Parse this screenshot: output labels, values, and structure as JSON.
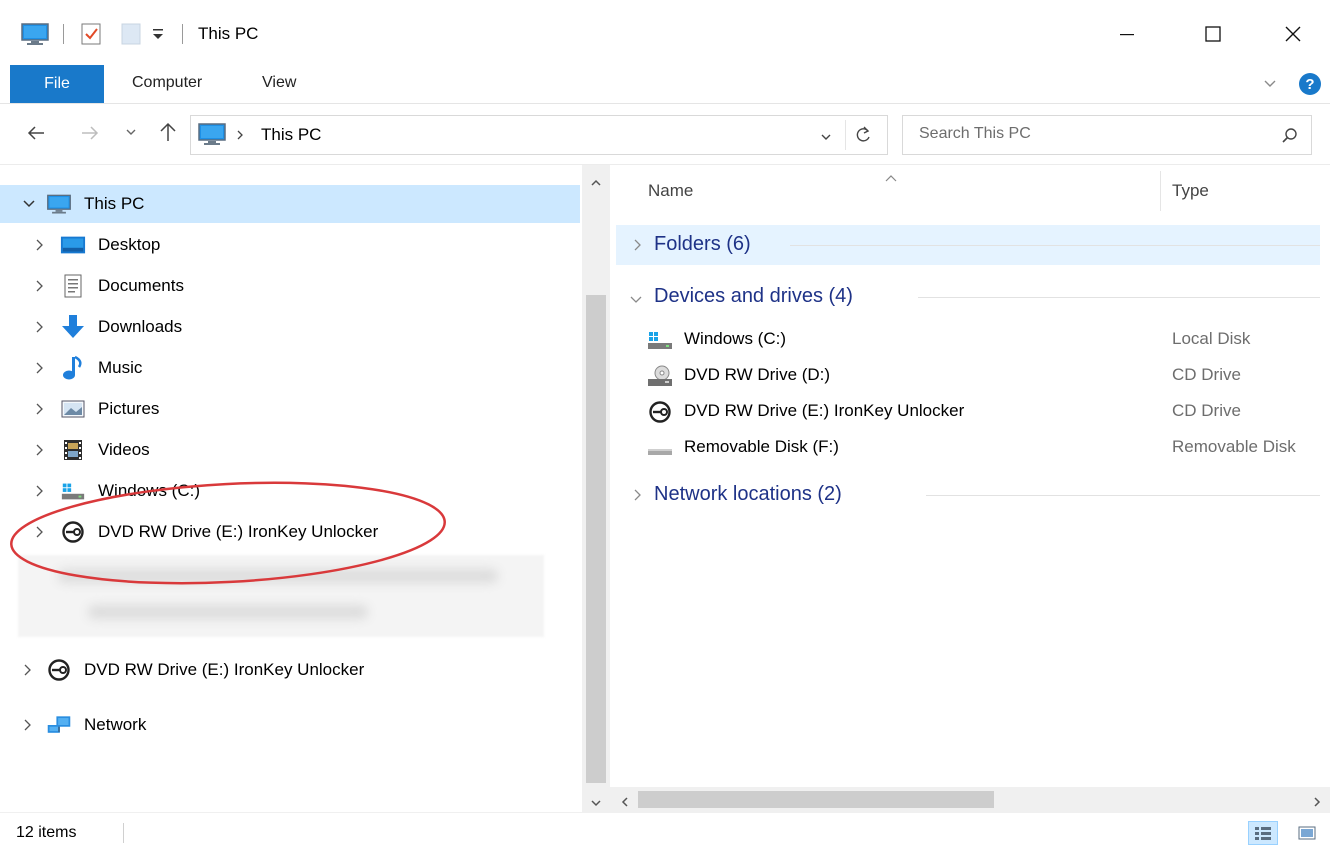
{
  "window": {
    "title": "This PC",
    "qat_dropdown_glyph": "=",
    "icon": "this-pc-icon"
  },
  "ribbon": {
    "tabs": [
      {
        "label": "File",
        "active": true
      },
      {
        "label": "Computer"
      },
      {
        "label": "View"
      }
    ],
    "accent_color": "#1979ca"
  },
  "address_bar": {
    "path": "This PC",
    "search_placeholder": "Search This PC"
  },
  "nav_pane": {
    "items": [
      {
        "label": "This PC",
        "icon": "this-pc-icon",
        "expanded": true,
        "selected": true
      },
      {
        "label": "Desktop",
        "icon": "desktop-icon"
      },
      {
        "label": "Documents",
        "icon": "documents-icon"
      },
      {
        "label": "Downloads",
        "icon": "downloads-icon"
      },
      {
        "label": "Music",
        "icon": "music-icon"
      },
      {
        "label": "Pictures",
        "icon": "pictures-icon"
      },
      {
        "label": "Videos",
        "icon": "videos-icon"
      },
      {
        "label": "Windows (C:)",
        "icon": "windows-drive-icon"
      },
      {
        "label": "DVD RW Drive (E:) IronKey Unlocker",
        "icon": "ironkey-icon"
      },
      {
        "label": "DVD RW Drive (E:) IronKey Unlocker",
        "icon": "ironkey-icon"
      },
      {
        "label": "Network",
        "icon": "network-icon"
      }
    ],
    "selection_color": "#cce8ff",
    "annotation_color": "#d9393b"
  },
  "content": {
    "columns": {
      "name": "Name",
      "type": "Type"
    },
    "groups": [
      {
        "label": "Folders (6)",
        "collapsed": true
      },
      {
        "label": "Devices and drives (4)",
        "collapsed": false
      },
      {
        "label": "Network locations (2)",
        "collapsed": true
      }
    ],
    "devices": [
      {
        "name": "Windows (C:)",
        "type": "Local Disk",
        "icon": "windows-drive-icon"
      },
      {
        "name": "DVD RW Drive (D:)",
        "type": "CD Drive",
        "icon": "dvd-drive-icon"
      },
      {
        "name": "DVD RW Drive (E:) IronKey Unlocker",
        "type": "CD Drive",
        "icon": "ironkey-icon"
      },
      {
        "name": "Removable Disk (F:)",
        "type": "Removable Disk",
        "icon": "removable-disk-icon"
      }
    ],
    "group_color": "#1e3287"
  },
  "status": {
    "item_count": "12 items"
  }
}
